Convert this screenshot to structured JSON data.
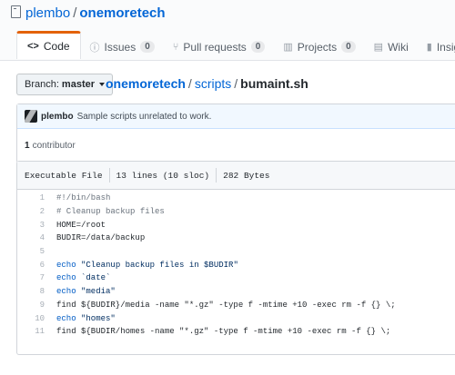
{
  "repo": {
    "owner": "plembo",
    "separator": "/",
    "name": "onemoretech"
  },
  "tabs": [
    {
      "label": "Code",
      "icon": "<>"
    },
    {
      "label": "Issues",
      "count": "0",
      "icon": "ⓘ"
    },
    {
      "label": "Pull requests",
      "count": "0",
      "icon": "⑂"
    },
    {
      "label": "Projects",
      "count": "0",
      "icon": "▥"
    },
    {
      "label": "Wiki",
      "icon": "▤"
    },
    {
      "label": "Insights",
      "icon": "▮"
    }
  ],
  "branch": {
    "prefix": "Branch:",
    "name": "master"
  },
  "breadcrumb": {
    "root": "onemoretech",
    "sep1": "/",
    "folder": "scripts",
    "sep2": "/",
    "file": "bumaint.sh"
  },
  "commit": {
    "author": "plembo",
    "message": "Sample scripts unrelated to work."
  },
  "contributors": {
    "count": "1",
    "label": "contributor"
  },
  "file_info": {
    "mode": "Executable File",
    "lines": "13 lines (10 sloc)",
    "size": "282 Bytes"
  },
  "code": [
    {
      "n": "1",
      "t": "#!/bin/bash"
    },
    {
      "n": "2",
      "t": "# Cleanup backup files"
    },
    {
      "n": "3",
      "t": "HOME=/root"
    },
    {
      "n": "4",
      "t": "BUDIR=/data/backup"
    },
    {
      "n": "5",
      "t": ""
    },
    {
      "n": "6",
      "kw": "echo",
      "t": " \"Cleanup backup files in $BUDIR\""
    },
    {
      "n": "7",
      "kw": "echo",
      "t": " `date`"
    },
    {
      "n": "8",
      "kw": "echo",
      "t": " \"media\""
    },
    {
      "n": "9",
      "t": "find ${BUDIR}/media -name \"*.gz\" -type f -mtime +10 -exec rm -f {} \\;"
    },
    {
      "n": "10",
      "kw": "echo",
      "t": " \"homes\""
    },
    {
      "n": "11",
      "t": "find ${BUDIR/homes -name \"*.gz\" -type f -mtime +10 -exec rm -f {} \\;"
    }
  ]
}
